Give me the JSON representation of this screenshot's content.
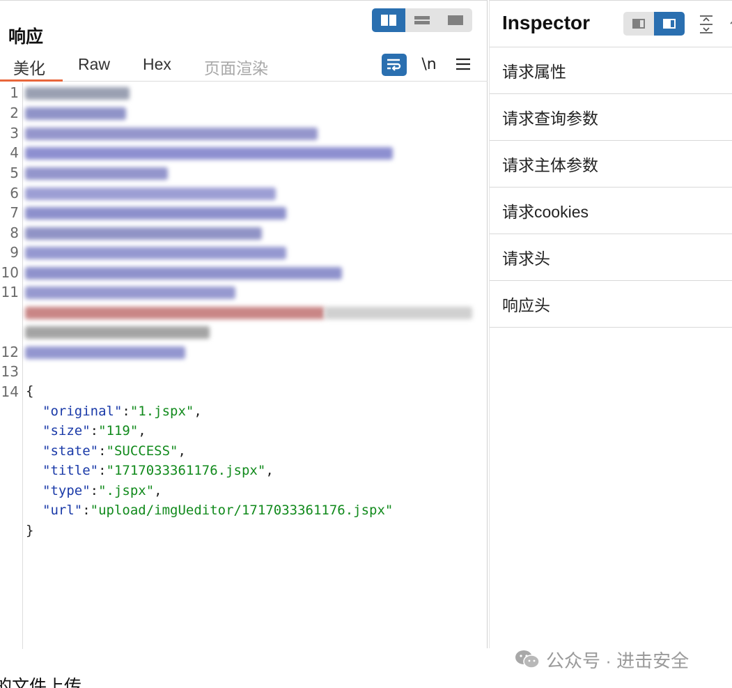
{
  "response_panel": {
    "title": "响应",
    "tabs": [
      "美化",
      "Raw",
      "Hex",
      "页面渲染"
    ],
    "active_tab": "美化",
    "tools": {
      "wrap": "wrap-lines",
      "newline_label": "\\n",
      "menu": "menu"
    },
    "line_numbers": [
      "1",
      "2",
      "3",
      "4",
      "5",
      "6",
      "7",
      "8",
      "9",
      "10",
      "11",
      "12",
      "13",
      "14"
    ],
    "json_body": {
      "open_brace": "{",
      "close_brace": "}",
      "fields": [
        {
          "key": "\"original\"",
          "value": "\"1.jspx\"",
          "tail": ","
        },
        {
          "key": "\"size\"",
          "value": "\"119\"",
          "tail": ","
        },
        {
          "key": "\"state\"",
          "value": "\"SUCCESS\"",
          "tail": ","
        },
        {
          "key": "\"title\"",
          "value": "\"1717033361176.jspx\"",
          "tail": ","
        },
        {
          "key": "\"type\"",
          "value": "\".jspx\"",
          "tail": ","
        },
        {
          "key": "\"url\"",
          "value": "\"upload/imgUeditor/1717033361176.jspx\"",
          "tail": ""
        }
      ]
    }
  },
  "inspector": {
    "title": "Inspector",
    "items": [
      "请求属性",
      "请求查询参数",
      "请求主体参数",
      "请求cookies",
      "请求头",
      "响应头"
    ]
  },
  "watermark": {
    "text": "公众号 · 进击安全"
  },
  "footer": {
    "text": "的文件上传。"
  },
  "colors": {
    "accent": "#2a6fb0",
    "tab_underline": "#e8663b",
    "json_key": "#1a3aa8",
    "json_string": "#118a1c"
  }
}
